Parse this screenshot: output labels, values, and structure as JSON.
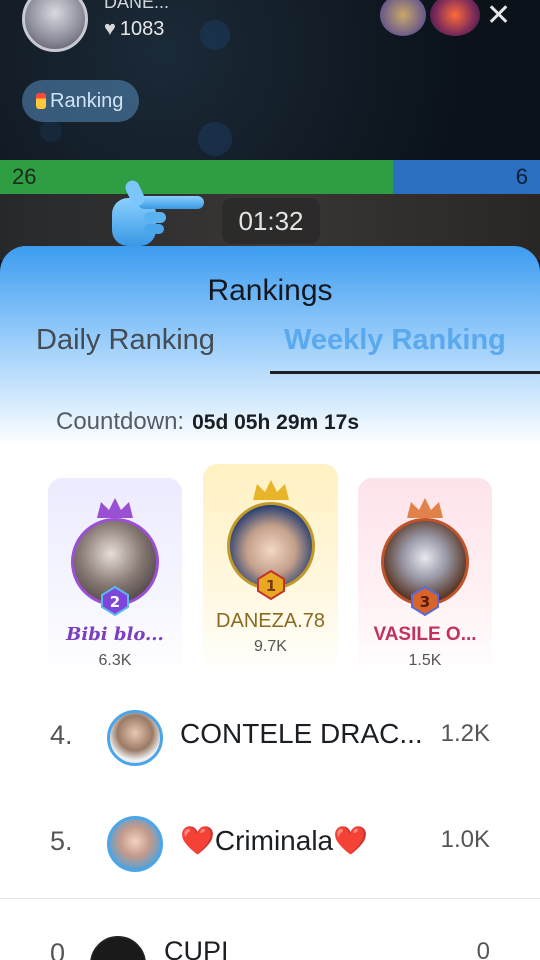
{
  "stream": {
    "host_name": "DANE...",
    "host_likes": "1083",
    "ranking_pill": "Ranking",
    "pk_left_score": "26",
    "pk_right_score": "6",
    "timer": "01:32",
    "pk_left_fraction": 0.728
  },
  "icons": {
    "close": "close-icon",
    "hand": "pointing-hand-icon",
    "heart": "heart-icon",
    "crown": "crown-icon",
    "medal": "medal-icon"
  },
  "colors": {
    "pk_left": "#2f9d41",
    "pk_right": "#2a6fc0",
    "accent_blue": "#5aa8ee",
    "second_purple": "#9b4fd2",
    "first_gold": "#c29a2a",
    "third_red": "#c2325f"
  },
  "sheet": {
    "title": "Rankings",
    "tabs": [
      {
        "label": "Daily Ranking",
        "active": false
      },
      {
        "label": "Weekly Ranking",
        "active": true
      }
    ],
    "countdown_label": "Countdown:",
    "countdown_value": "05d 05h 29m 17s"
  },
  "podium": {
    "second": {
      "rank": "2",
      "name": "Bibi blo...",
      "score": "6.3K"
    },
    "first": {
      "rank": "1",
      "name": "DANEZA.78",
      "score": "9.7K"
    },
    "third": {
      "rank": "3",
      "name": "VASILE O...",
      "score": "1.5K"
    }
  },
  "list": [
    {
      "rank": "4.",
      "name": "CONTELE DRAC...",
      "score": "1.2K"
    },
    {
      "rank": "5.",
      "name": "❤️Criminala❤️",
      "score": "1.0K"
    }
  ],
  "self_row": {
    "rank": "0",
    "name": "CUPI",
    "score": "0"
  }
}
